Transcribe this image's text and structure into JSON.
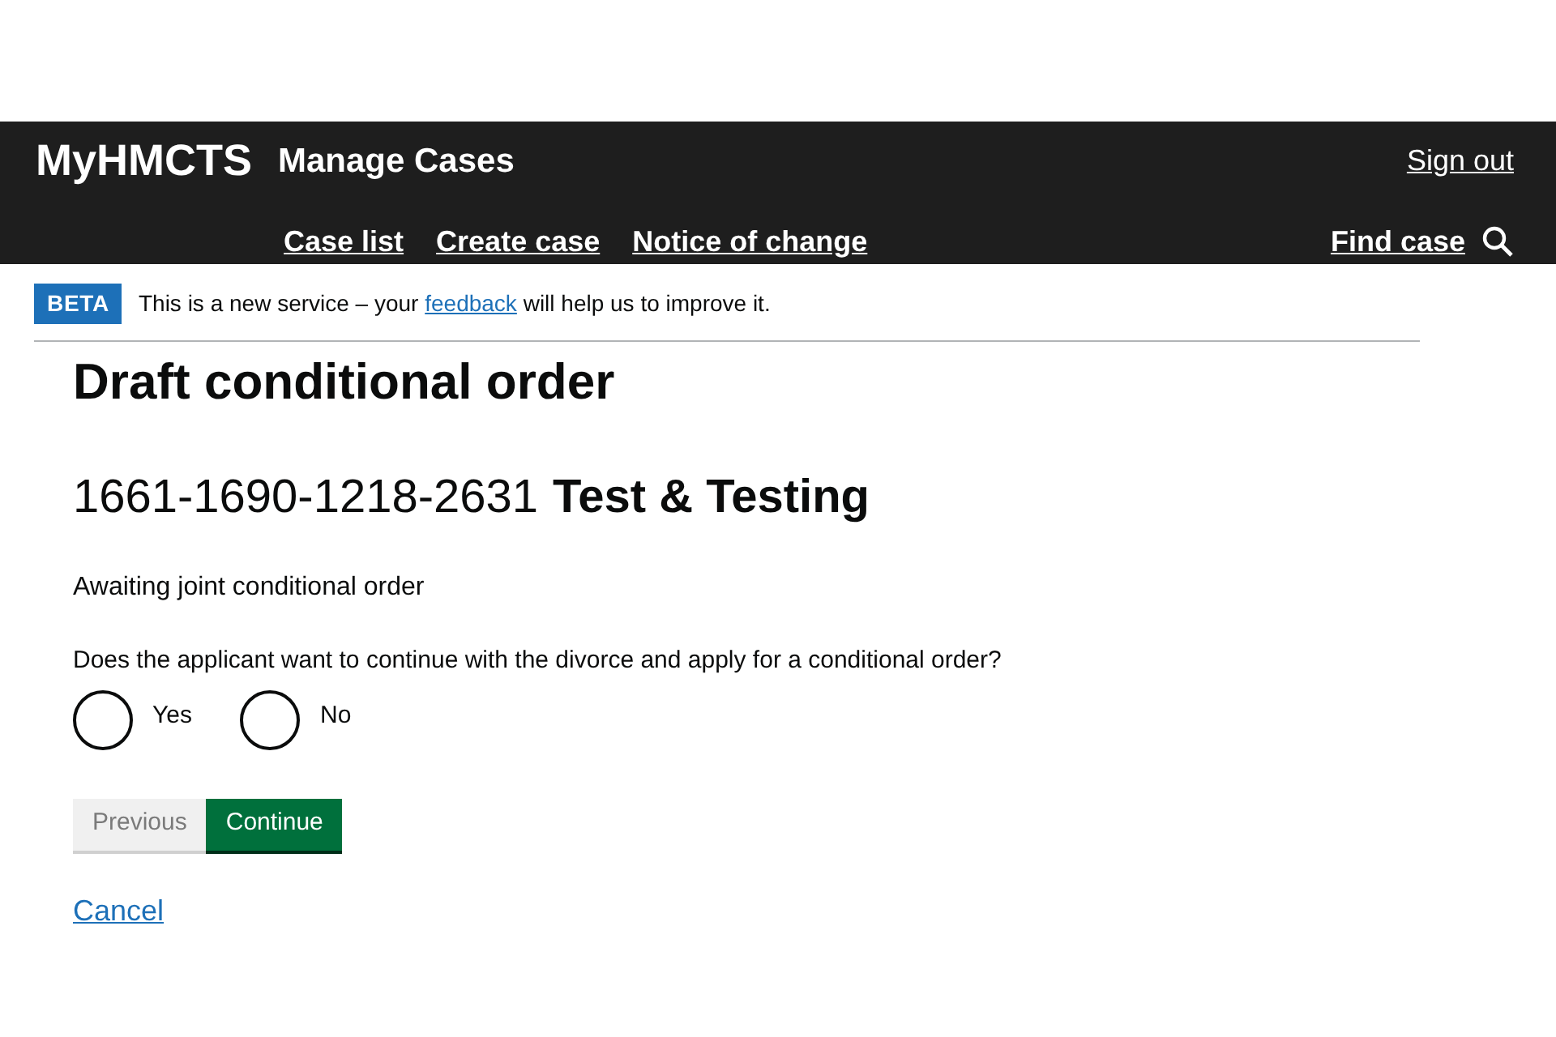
{
  "header": {
    "logo": "MyHMCTS",
    "service": "Manage Cases",
    "sign_out": "Sign out",
    "nav": [
      {
        "label": "Case list"
      },
      {
        "label": "Create case"
      },
      {
        "label": "Notice of change"
      }
    ],
    "find_case": "Find case"
  },
  "banner": {
    "tag": "BETA",
    "text_before": "This is a new service – your ",
    "link": "feedback",
    "text_after": " will help us to improve it."
  },
  "page": {
    "title": "Draft conditional order",
    "case_number": "1661-1690-1218-2631",
    "case_name": "Test & Testing",
    "state": "Awaiting joint conditional order",
    "question": "Does the applicant want to continue with the divorce and apply for a conditional order?",
    "options": [
      {
        "label": "Yes",
        "selected": false
      },
      {
        "label": "No",
        "selected": false
      }
    ],
    "buttons": [
      {
        "label": "Previous",
        "kind": "secondary"
      },
      {
        "label": "Continue",
        "kind": "primary"
      }
    ],
    "cancel": "Cancel"
  }
}
